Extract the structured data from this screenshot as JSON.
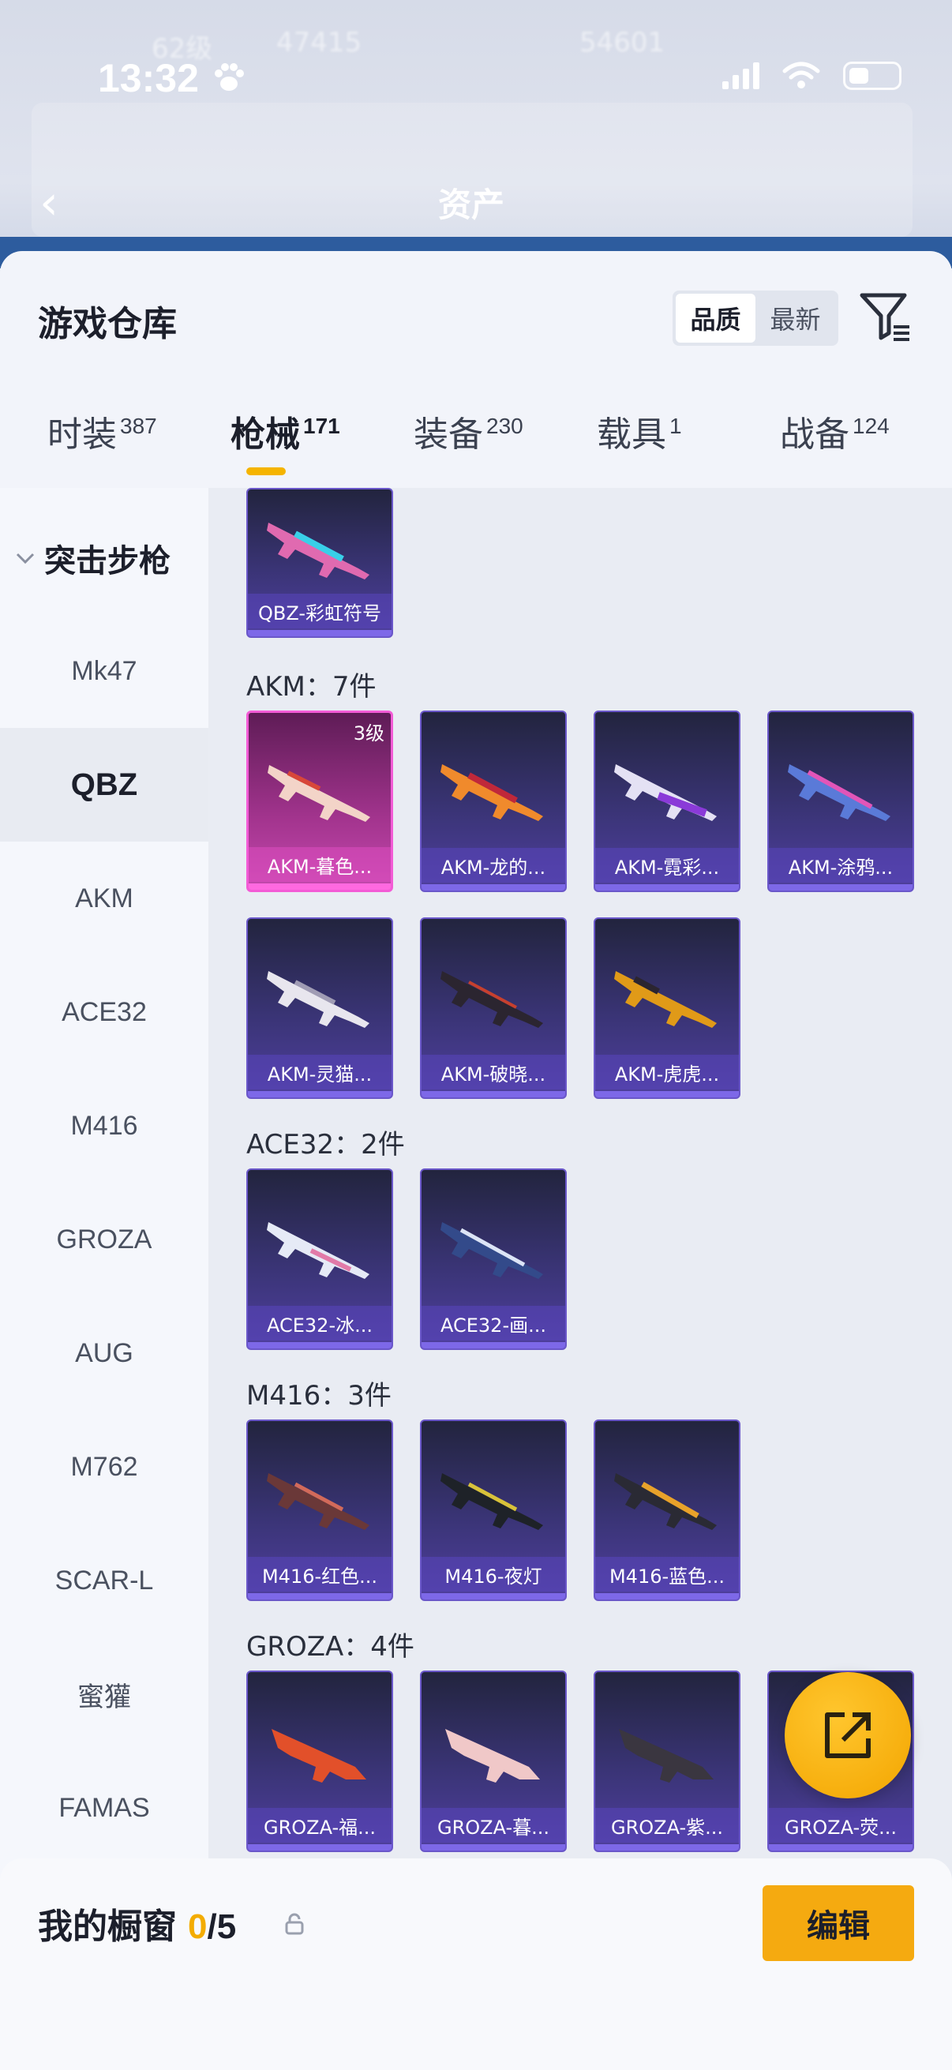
{
  "status_bar": {
    "time": "13:32"
  },
  "header": {
    "title": "资产"
  },
  "background_ghost": {
    "level": "62级",
    "score_a": "47415",
    "score_b": "54601"
  },
  "sheet": {
    "title": "游戏仓库",
    "sort_options": [
      "品质",
      "最新"
    ],
    "sort_selected": "品质"
  },
  "tabs": [
    {
      "label": "时装",
      "count": "387"
    },
    {
      "label": "枪械",
      "count": "171"
    },
    {
      "label": "装备",
      "count": "230"
    },
    {
      "label": "载具",
      "count": "1"
    },
    {
      "label": "战备",
      "count": "124"
    }
  ],
  "active_tab": "枪械",
  "sidebar": {
    "category": "突击步枪",
    "items": [
      "Mk47",
      "QBZ",
      "AKM",
      "ACE32",
      "M416",
      "GROZA",
      "AUG",
      "M762",
      "SCAR-L",
      "蜜獾",
      "FAMAS"
    ],
    "active": "QBZ"
  },
  "groups": {
    "qbz": {
      "items": [
        {
          "label": "QBZ-彩虹符号"
        }
      ]
    },
    "akm": {
      "title": "AKM：7件",
      "items": [
        {
          "label": "AKM-暮色...",
          "level": "3级"
        },
        {
          "label": "AKM-龙的..."
        },
        {
          "label": "AKM-霓彩..."
        },
        {
          "label": "AKM-涂鸦..."
        },
        {
          "label": "AKM-灵猫..."
        },
        {
          "label": "AKM-破晓..."
        },
        {
          "label": "AKM-虎虎..."
        }
      ]
    },
    "ace32": {
      "title": "ACE32：2件",
      "items": [
        {
          "label": "ACE32-冰..."
        },
        {
          "label": "ACE32-画..."
        }
      ]
    },
    "m416": {
      "title": "M416：3件",
      "items": [
        {
          "label": "M416-红色..."
        },
        {
          "label": "M416-夜灯"
        },
        {
          "label": "M416-蓝色..."
        }
      ]
    },
    "groza": {
      "title": "GROZA：4件",
      "items": [
        {
          "label": "GROZA-福..."
        },
        {
          "label": "GROZA-暮..."
        },
        {
          "label": "GROZA-紫..."
        },
        {
          "label": "GROZA-荧..."
        }
      ]
    }
  },
  "footer": {
    "label": "我的橱窗",
    "count": "0",
    "total": "/5",
    "edit_button": "编辑"
  },
  "colors": {
    "accent": "#f5aa10",
    "tab_indicator": "#f5b400",
    "card_purple": "#4f3f9e",
    "card_pink": "#c449ae"
  }
}
